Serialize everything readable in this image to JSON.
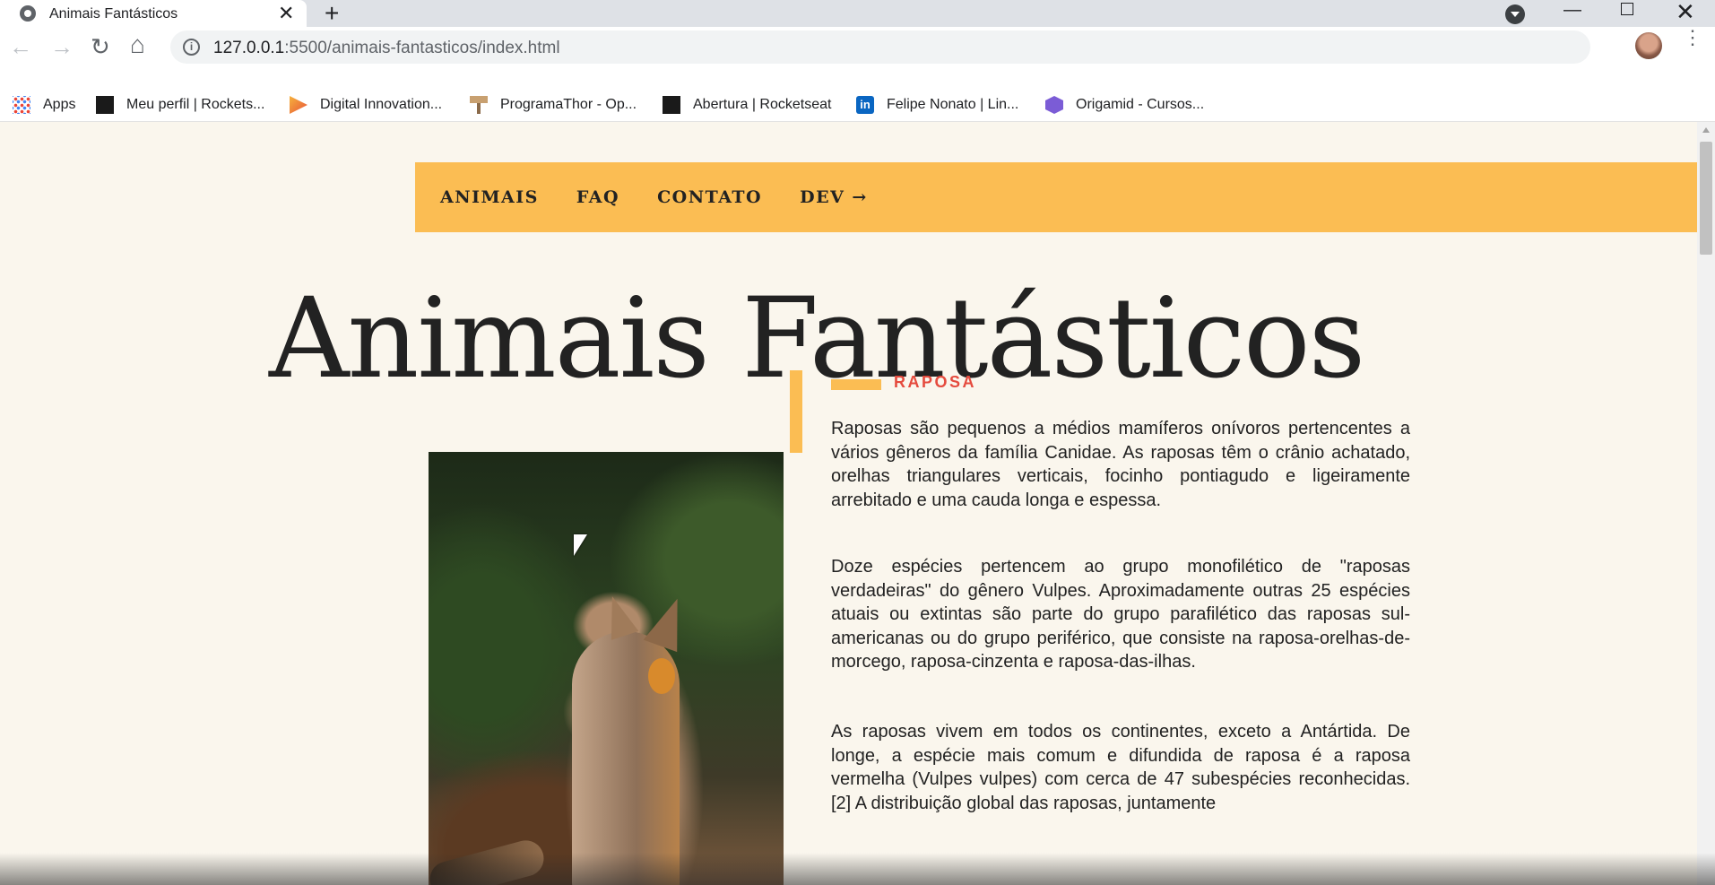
{
  "browser": {
    "tab": {
      "title": "Animais Fantásticos",
      "close_glyph": "✕",
      "favicon": "globe-icon"
    },
    "new_tab_glyph": "+",
    "window_controls": {
      "minimize_glyph": "—",
      "close_glyph": "✕"
    },
    "nav": {
      "back_glyph": "←",
      "forward_glyph": "→",
      "reload_glyph": "↻",
      "home_glyph": "⌂"
    },
    "address": {
      "host": "127.0.0.1",
      "rest": ":5500/animais-fantasticos/index.html",
      "info_glyph": "i"
    },
    "star_glyph": "☆",
    "menu_glyph": "⋮",
    "bookmarks": [
      {
        "label": "Apps",
        "icon": "apps-grid-icon"
      },
      {
        "label": "Meu perfil | Rockets...",
        "icon": "rocketseat-icon"
      },
      {
        "label": "Digital Innovation...",
        "icon": "dio-icon"
      },
      {
        "label": "ProgramaThor - Op...",
        "icon": "hammer-icon"
      },
      {
        "label": "Abertura | Rocketseat",
        "icon": "rocketseat-icon"
      },
      {
        "label": "Felipe Nonato | Lin...",
        "icon": "linkedin-icon"
      },
      {
        "label": "Origamid - Cursos...",
        "icon": "origamid-icon"
      }
    ],
    "linkedin_glyph": "in"
  },
  "site": {
    "nav": [
      "ANIMAIS",
      "FAQ",
      "CONTATO",
      "DEV →"
    ],
    "title": "Animais Fantásticos",
    "section": {
      "tag": "RAPOSA",
      "paragraphs": [
        "Raposas são pequenos a médios mamíferos onívoros pertencentes a vários gêneros da família Canidae. As raposas têm o crânio achatado, orelhas triangulares verticais, focinho pontiagudo e ligeiramente arrebitado e uma cauda longa e espessa.",
        "Doze espécies pertencem ao grupo monofilético de \"raposas verdadeiras\" do gênero Vulpes. Aproximadamente outras 25 espécies atuais ou extintas são parte do grupo parafilético das raposas sul-americanas ou do grupo periférico, que consiste na raposa-orelhas-de-morcego, raposa-cinzenta e raposa-das-ilhas.",
        "As raposas vivem em todos os continentes, exceto a Antártida. De longe, a espécie mais comum e difundida de raposa é a raposa vermelha (Vulpes vulpes) com cerca de 47 subespécies reconhecidas.[2] A distribuição global das raposas, juntamente"
      ]
    }
  },
  "colors": {
    "accent": "#fbbd53",
    "tag": "#e54b3e",
    "page_bg": "#faf6ed",
    "text": "#222222"
  }
}
